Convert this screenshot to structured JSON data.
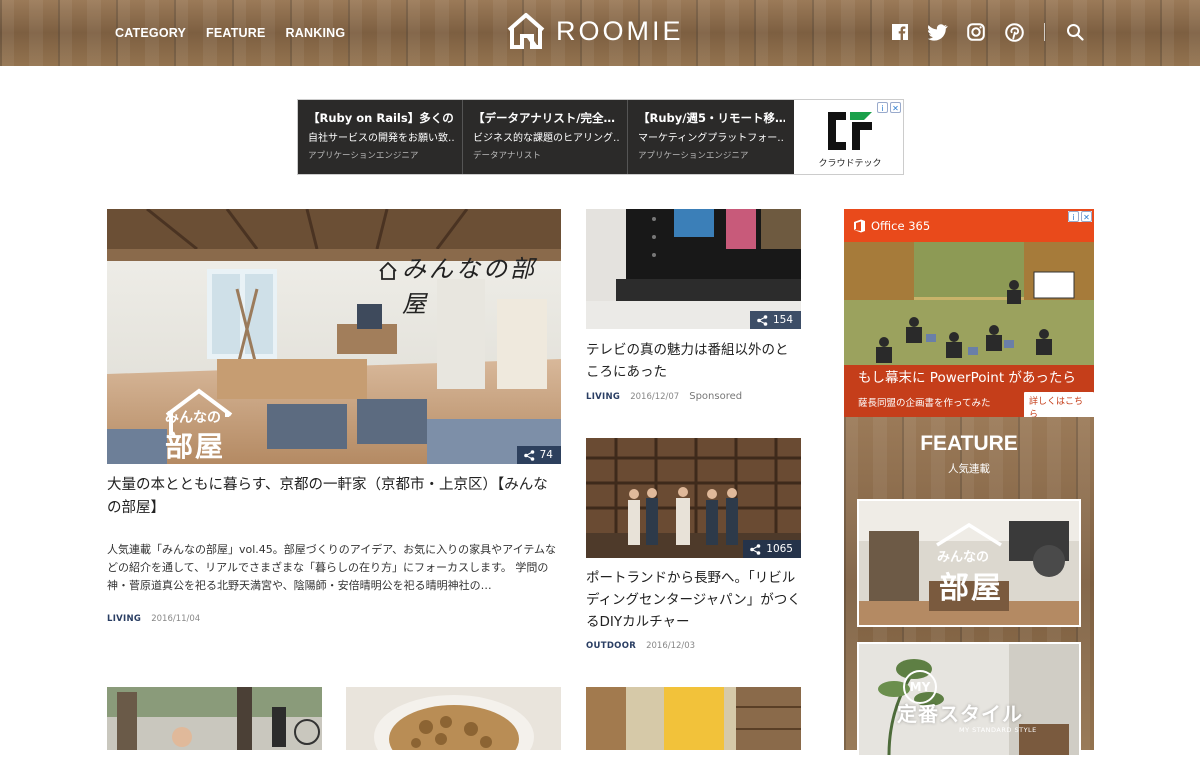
{
  "header": {
    "nav": [
      "CATEGORY",
      "FEATURE",
      "RANKING"
    ],
    "logo_text": "ROOMIE",
    "social_icons": [
      "facebook-icon",
      "twitter-icon",
      "instagram-icon",
      "pinterest-icon",
      "search-icon"
    ]
  },
  "top_ad": {
    "columns": [
      {
        "title": "【Ruby on Rails】多くの…",
        "body": "自社サービスの開発をお願い致…",
        "role": "アプリケーションエンジニア"
      },
      {
        "title": "【データアナリスト/完全…",
        "body": "ビジネス的な課題のヒアリング…",
        "role": "データアナリスト"
      },
      {
        "title": "【Ruby/週5・リモート移…",
        "body": "マーケティングプラットフォー…",
        "role": "アプリケーションエンジニア"
      }
    ],
    "logo_caption": "クラウドテック"
  },
  "articles": [
    {
      "title": "大量の本とともに暮らす、京都の一軒家（京都市・上京区）【みんなの部屋】",
      "excerpt": "人気連載「みんなの部屋」vol.45。部屋づくりのアイデア、お気に入りの家具やアイテムなどの紹介を通して、リアルでさまざまな「暮らしの在り方」にフォーカスします。 学問の神・菅原道真公を祀る北野天満宮や、陰陽師・安倍晴明公を祀る晴明神社の…",
      "category": "LIVING",
      "date": "2016/11/04",
      "shares": "74",
      "overlay_caption": "みんなの部屋",
      "logo_line1": "みんなの",
      "logo_line2": "部屋"
    },
    {
      "title": "テレビの真の魅力は番組以外のところにあった",
      "category": "LIVING",
      "date": "2016/12/07",
      "sponsored": "Sponsored",
      "shares": "154"
    },
    {
      "title": "ポートランドから長野へ。「リビルディングセンタージャパン」がつくるDIYカルチャー",
      "category": "OUTDOOR",
      "date": "2016/12/03",
      "shares": "1065"
    }
  ],
  "sidebar": {
    "ad": {
      "brand": "Office 365",
      "caption1": "もし幕末に PowerPoint があったら",
      "caption2": "薩長同盟の企画書を作ってみた",
      "button": "詳しくはこちら"
    },
    "feature": {
      "title": "FEATURE",
      "subtitle": "人気連載",
      "card1_line1": "みんなの",
      "card1_line2": "部屋",
      "card2_badge": "MY",
      "card2_title": "定番スタイル",
      "card2_sub": "MY STANDARD STYLE"
    }
  },
  "colors": {
    "accent_navy": "#2a3e63",
    "office_orange": "#e94a1b"
  }
}
